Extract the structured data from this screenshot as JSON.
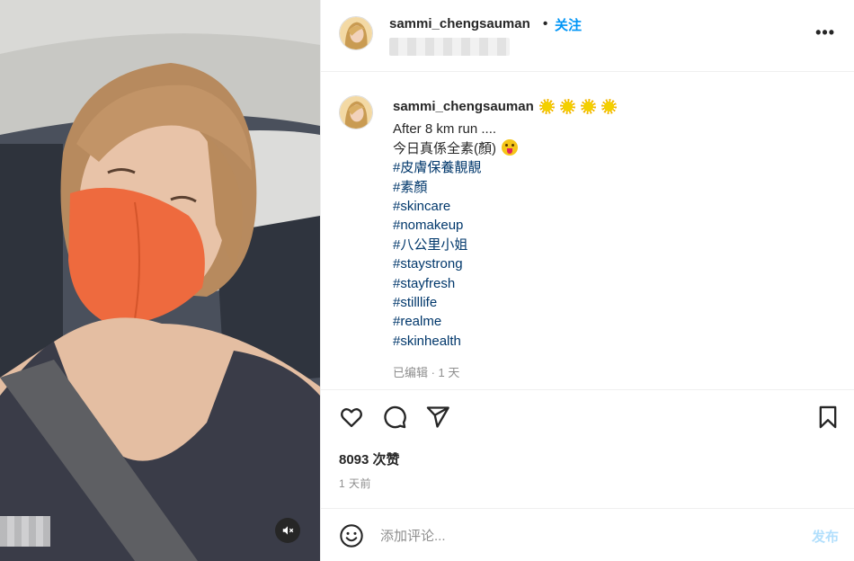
{
  "post": {
    "username": "sammi_chengsauman",
    "separator": "•",
    "follow_label": "关注",
    "more_label": "•••"
  },
  "caption": {
    "username": "sammi_chengsauman",
    "emoji_note": "four sun emoji",
    "lines": [
      "After 8 km run ....",
      "今日真係全素(顏)"
    ],
    "hashtags": [
      "#皮膚保養靚靚",
      "#素顏",
      "#skincare",
      "#nomakeup",
      "#八公里小姐",
      "#staystrong",
      "#stayfresh",
      "#stilllife",
      "#realme",
      "#skinhealth"
    ],
    "meta": "已编辑 · 1 天"
  },
  "actions": {
    "icons": [
      "heart-icon",
      "comment-icon",
      "share-icon",
      "bookmark-icon"
    ]
  },
  "likes": "8093 次赞",
  "timestamp": "1 天前",
  "comment": {
    "placeholder": "添加评论...",
    "post_label": "发布"
  },
  "colors": {
    "link_blue": "#0095f6",
    "hashtag_blue": "#00376b",
    "muted_gray": "#8e8e8e",
    "post_disabled": "#b2dffc",
    "mask_orange": "#ee6a3e"
  }
}
